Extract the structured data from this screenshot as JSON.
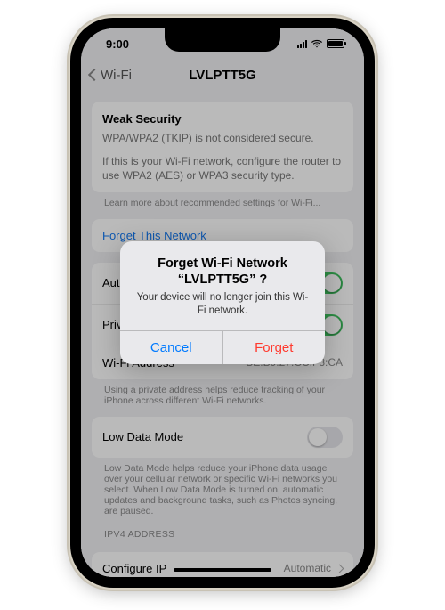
{
  "status": {
    "time": "9:00"
  },
  "nav": {
    "back": "Wi-Fi",
    "title": "LVLPTT5G"
  },
  "security": {
    "heading": "Weak Security",
    "line1": "WPA/WPA2 (TKIP) is not considered secure.",
    "line2": "If this is your Wi-Fi network, configure the router to use WPA2 (AES) or WPA3 security type.",
    "learn": "Learn more about recommended settings for Wi-Fi..."
  },
  "rows": {
    "forget": "Forget This Network",
    "auto_join": "Auto-Join",
    "private_addr": "Private Address",
    "wifi_addr_label": "Wi-Fi Address",
    "wifi_addr_value": "BE:B9:27:CC:F3:CA",
    "private_note": "Using a private address helps reduce tracking of your iPhone across different Wi-Fi networks.",
    "low_data": "Low Data Mode",
    "low_data_note": "Low Data Mode helps reduce your iPhone data usage over your cellular network or specific Wi-Fi networks you select. When Low Data Mode is turned on, automatic updates and background tasks, such as Photos syncing, are paused.",
    "ipv4_label": "IPV4 ADDRESS",
    "configure_ip": "Configure IP",
    "configure_ip_value": "Automatic"
  },
  "alert": {
    "title": "Forget Wi-Fi Network “LVLPTT5G” ?",
    "message": "Your device will no longer join this Wi-Fi network.",
    "cancel": "Cancel",
    "forget": "Forget"
  }
}
